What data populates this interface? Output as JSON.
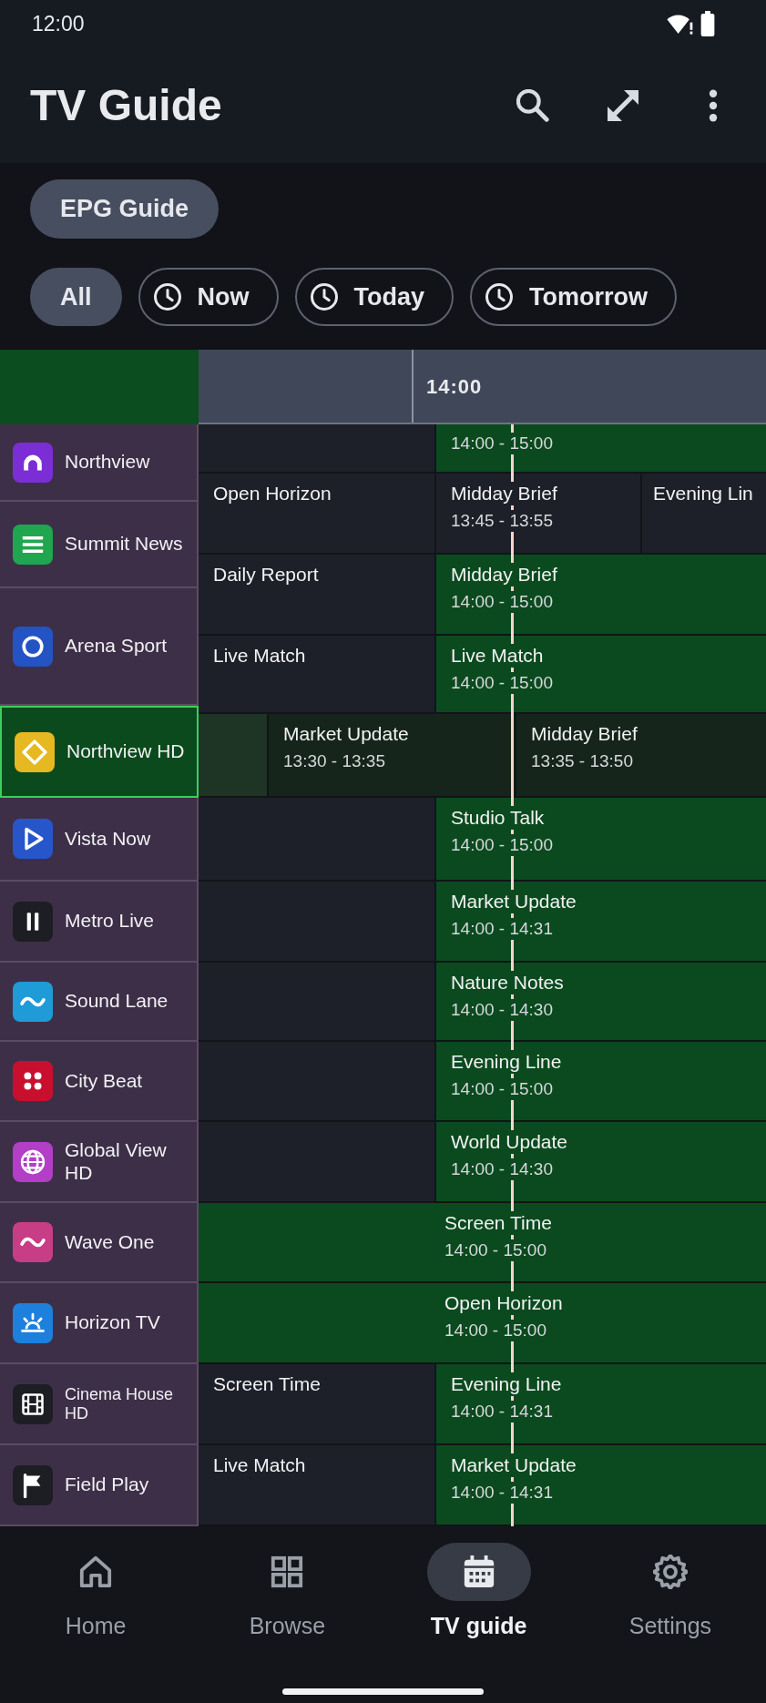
{
  "status_bar": {
    "time": "12:00"
  },
  "app_bar": {
    "title": "TV Guide"
  },
  "view_chip": {
    "label": "EPG Guide"
  },
  "filters": [
    {
      "label": "All",
      "kind": "plain",
      "selected": true
    },
    {
      "label": "Now",
      "kind": "time",
      "selected": false
    },
    {
      "label": "Today",
      "kind": "time",
      "selected": false
    },
    {
      "label": "Tomorrow",
      "kind": "time",
      "selected": false
    }
  ],
  "guide": {
    "timeline": [
      "14:00"
    ],
    "channels": [
      {
        "name": "Northview",
        "color": "#7b2ed6",
        "selected": false
      },
      {
        "name": "Summit News",
        "color": "#1fa64e",
        "selected": false
      },
      {
        "name": "Arena Sport",
        "color": "#2453c4",
        "selected": false
      },
      {
        "name": "Northview HD",
        "color": "#e6b822",
        "selected": true
      },
      {
        "name": "Vista Now",
        "color": "#2656c9",
        "selected": false
      },
      {
        "name": "Metro Live",
        "color": "#1c1e24",
        "selected": false
      },
      {
        "name": "Sound Lane",
        "color": "#1f9bd7",
        "selected": false
      },
      {
        "name": "City Beat",
        "color": "#c8102e",
        "selected": false
      },
      {
        "name": "Global View HD",
        "color": "#b23fc6",
        "selected": false
      },
      {
        "name": "Wave One",
        "color": "#c83e86",
        "selected": false
      },
      {
        "name": "Horizon TV",
        "color": "#1d80dd",
        "selected": false
      },
      {
        "name": "Cinema House HD",
        "color": "#1c1e24",
        "selected": false
      },
      {
        "name": "Field Play",
        "color": "#1c1e24",
        "selected": false
      }
    ],
    "rows": [
      {
        "selected": false,
        "programs": [
          {
            "airing": false
          },
          {
            "time": "14:00 - 15:00",
            "airing": true
          }
        ]
      },
      {
        "selected": false,
        "programs": [
          {
            "title": "Open Horizon",
            "airing": false
          },
          {
            "title": "Midday Brief",
            "time": "13:45 - 13:55",
            "airing": false
          },
          {
            "title": "Evening Lin",
            "airing": false
          }
        ]
      },
      {
        "selected": false,
        "programs": [
          {
            "title": "Daily Report",
            "airing": false
          },
          {
            "title": "Midday Brief",
            "time": "14:00 - 15:00",
            "airing": true
          }
        ]
      },
      {
        "selected": false,
        "programs": [
          {
            "title": "Live Match",
            "airing": false
          },
          {
            "title": "Live Match",
            "time": "14:00 - 15:00",
            "airing": true
          }
        ]
      },
      {
        "selected": true,
        "programs": [
          {
            "airing": false
          },
          {
            "title": "Market Update",
            "time": "13:30 - 13:35",
            "airing": false
          },
          {
            "title": "Midday Brief",
            "time": "13:35 - 13:50",
            "airing": false
          }
        ]
      },
      {
        "selected": false,
        "programs": [
          {
            "airing": false
          },
          {
            "title": "Studio Talk",
            "time": "14:00 - 15:00",
            "airing": true
          }
        ]
      },
      {
        "selected": false,
        "programs": [
          {
            "airing": false
          },
          {
            "title": "Market Update",
            "time": "14:00 - 14:31",
            "airing": true
          }
        ]
      },
      {
        "selected": false,
        "programs": [
          {
            "airing": false
          },
          {
            "title": "Nature Notes",
            "time": "14:00 - 14:30",
            "airing": true
          }
        ]
      },
      {
        "selected": false,
        "programs": [
          {
            "airing": false
          },
          {
            "title": "Evening Line",
            "time": "14:00 - 15:00",
            "airing": true
          }
        ]
      },
      {
        "selected": false,
        "programs": [
          {
            "airing": false
          },
          {
            "title": "World Update",
            "time": "14:00 - 14:30",
            "airing": true
          }
        ]
      },
      {
        "selected": false,
        "programs": [
          {
            "title": "Screen Time",
            "time": "14:00 - 15:00",
            "airing": true
          }
        ]
      },
      {
        "selected": false,
        "programs": [
          {
            "title": "Open Horizon",
            "time": "14:00 - 15:00",
            "airing": true
          }
        ]
      },
      {
        "selected": false,
        "programs": [
          {
            "title": "Screen Time",
            "airing": false
          },
          {
            "title": "Evening Line",
            "time": "14:00 - 14:31",
            "airing": true
          }
        ]
      },
      {
        "selected": false,
        "programs": [
          {
            "title": "Live Match",
            "airing": false
          },
          {
            "title": "Market Update",
            "time": "14:00 - 14:31",
            "airing": true
          }
        ]
      }
    ]
  },
  "bottom_nav": [
    {
      "label": "Home",
      "selected": false
    },
    {
      "label": "Browse",
      "selected": false
    },
    {
      "label": "TV guide",
      "selected": true
    },
    {
      "label": "Settings",
      "selected": false
    }
  ]
}
